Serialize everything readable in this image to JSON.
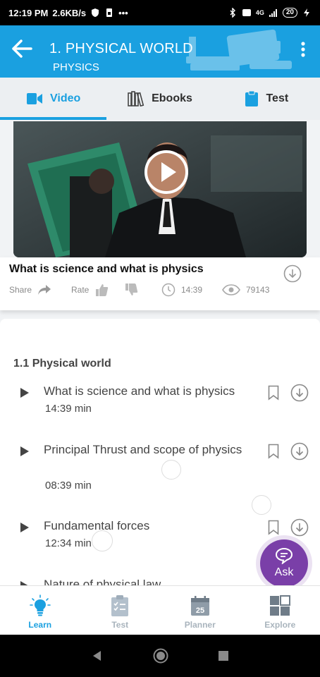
{
  "status_bar": {
    "time": "12:19 PM",
    "speed": "2.6KB/s",
    "dots": "•••",
    "network": "4G",
    "battery": "20"
  },
  "app_bar": {
    "title": "1. PHYSICAL WORLD",
    "subtitle": "PHYSICS",
    "accent_color": "#1aa0e0"
  },
  "tabs": [
    {
      "label": "Video",
      "active": true,
      "icon": "video-camera-icon"
    },
    {
      "label": "Ebooks",
      "active": false,
      "icon": "books-icon"
    },
    {
      "label": "Test",
      "active": false,
      "icon": "clipboard-icon"
    }
  ],
  "current_video": {
    "title": "What is science and what is physics",
    "share_label": "Share",
    "rate_label": "Rate",
    "duration": "14:39",
    "views": "79143"
  },
  "section": {
    "title": "1.1 Physical world",
    "items": [
      {
        "name": "What is science and what is physics",
        "duration": "14:39 min"
      },
      {
        "name": "Principal Thrust and scope of physics",
        "duration": "08:39 min"
      },
      {
        "name": "Fundamental forces",
        "duration": "12:34 min"
      },
      {
        "name": "Nature of physical law",
        "duration": ""
      }
    ]
  },
  "ask_button": {
    "label": "Ask",
    "color": "#7a3fa8"
  },
  "bottom_nav": [
    {
      "label": "Learn",
      "active": true,
      "icon": "bulb-icon"
    },
    {
      "label": "Test",
      "active": false,
      "icon": "checklist-icon"
    },
    {
      "label": "Planner",
      "active": false,
      "icon": "calendar-icon",
      "badge": "25"
    },
    {
      "label": "Explore",
      "active": false,
      "icon": "grid-icon"
    }
  ]
}
